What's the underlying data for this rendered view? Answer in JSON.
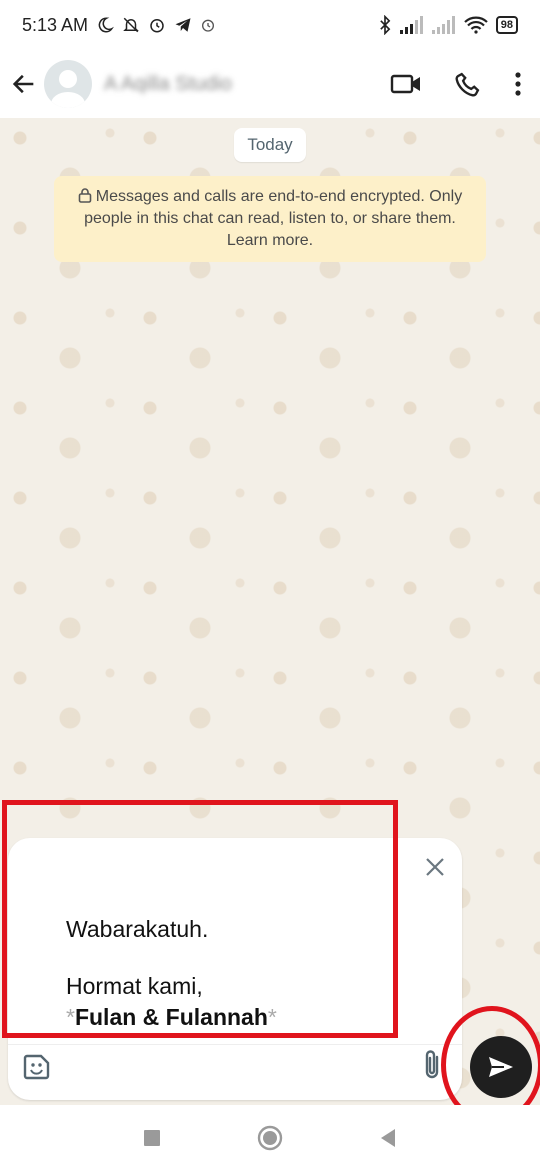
{
  "status_bar": {
    "time": "5:13 AM",
    "battery": "98",
    "icons": [
      "moon-icon",
      "muted-bell-icon",
      "alarm-icon",
      "telegram-icon",
      "alarm-icon",
      "bluetooth-icon",
      "signal-icon",
      "signal-icon",
      "wifi-icon",
      "battery-icon"
    ]
  },
  "header": {
    "contact_name": "A Aqilla Studio",
    "icons": [
      "back-arrow-icon",
      "video-call-icon",
      "phone-icon",
      "more-options-icon"
    ]
  },
  "chat": {
    "date_label": "Today",
    "encryption_notice": "Messages and calls are end-to-end encrypted. Only people in this chat can read, listen to, or share them. Learn more."
  },
  "composer": {
    "line1": "Wabarakatuh.",
    "line2": "Hormat kami,",
    "signature_star_open": "*",
    "signature": "Fulan & Fulannah",
    "signature_star_close": "*",
    "icons": [
      "close-icon",
      "sticker-icon",
      "attach-icon",
      "send-icon"
    ]
  },
  "colors": {
    "highlight": "#e0141d",
    "chat_background": "#f3efe7",
    "notice_background": "#fdf0c9",
    "send_button": "#1f1f1f"
  }
}
